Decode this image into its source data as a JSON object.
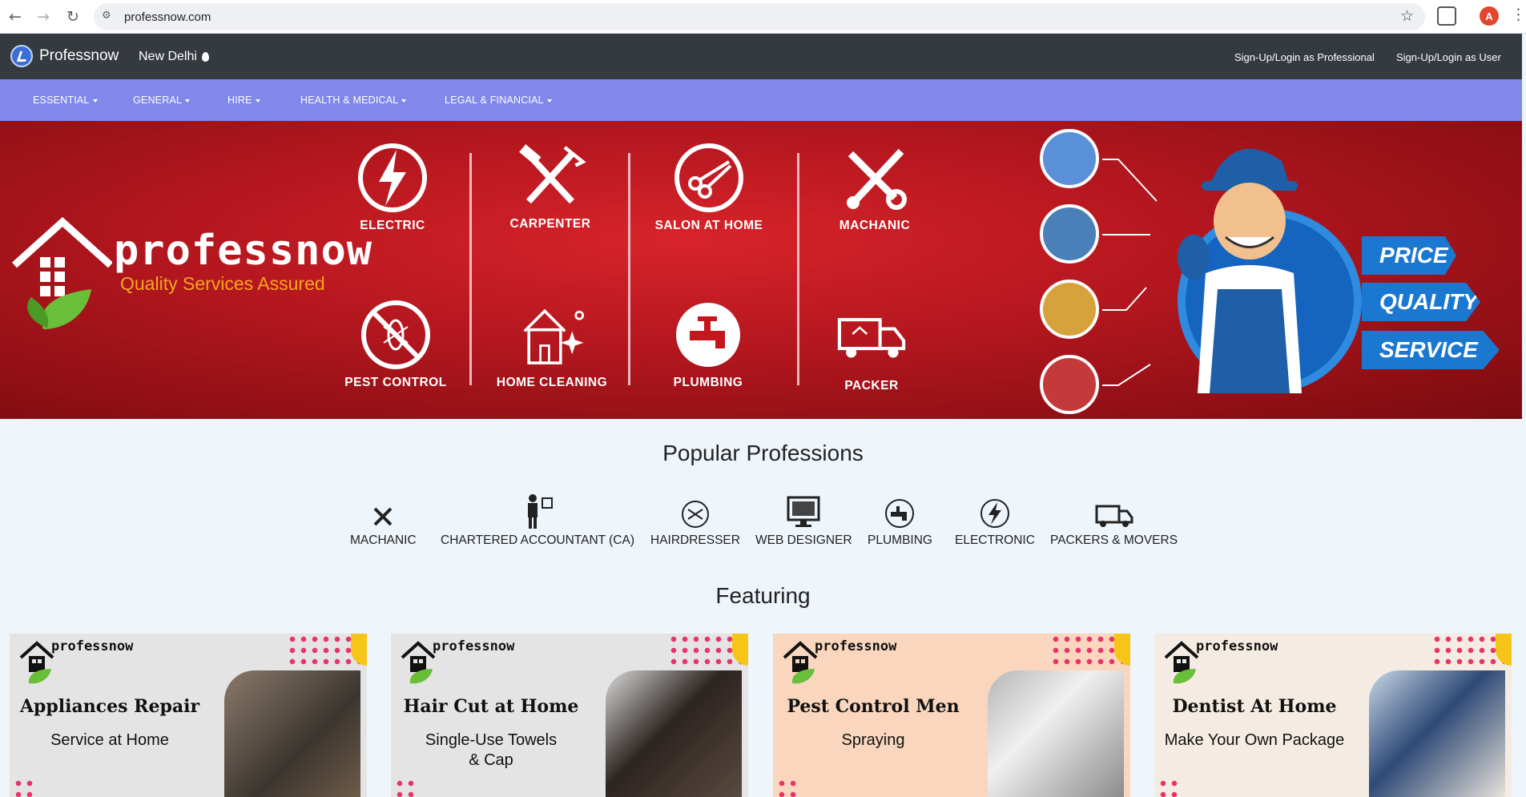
{
  "browser": {
    "url": "professnow.com",
    "profile_initial": "A"
  },
  "header": {
    "brand": "Professnow",
    "city": "New Delhi",
    "login_professional": "Sign-Up/Login as Professional",
    "login_user": "Sign-Up/Login as User"
  },
  "categories": [
    {
      "label": "ESSENTIAL"
    },
    {
      "label": "GENERAL"
    },
    {
      "label": "HIRE"
    },
    {
      "label": "HEALTH & MEDICAL"
    },
    {
      "label": "LEGAL & FINANCIAL"
    }
  ],
  "hero": {
    "logo_text": "professnow",
    "tagline": "Quality Services Assured",
    "services": [
      {
        "label": "ELECTRIC",
        "icon": "lightning-icon"
      },
      {
        "label": "CARPENTER",
        "icon": "hammer-saw-icon"
      },
      {
        "label": "SALON AT HOME",
        "icon": "scissors-comb-icon"
      },
      {
        "label": "MACHANIC",
        "icon": "wrench-screwdriver-icon"
      },
      {
        "label": "PEST CONTROL",
        "icon": "mosquito-icon"
      },
      {
        "label": "HOME CLEANING",
        "icon": "sparkle-house-icon"
      },
      {
        "label": "PLUMBING",
        "icon": "tap-icon"
      },
      {
        "label": "PACKER",
        "icon": "truck-icon"
      }
    ],
    "badges": [
      "PRICE",
      "QUALITY",
      "SERVICE"
    ]
  },
  "popular": {
    "title": "Popular Professions",
    "items": [
      {
        "label": "MACHANIC",
        "icon": "tools-icon"
      },
      {
        "label": "CHARTERED ACCOUNTANT (CA)",
        "icon": "accountant-icon"
      },
      {
        "label": "HAIRDRESSER",
        "icon": "scissors-icon"
      },
      {
        "label": "WEB DESIGNER",
        "icon": "monitor-icon"
      },
      {
        "label": "PLUMBING",
        "icon": "tap-icon"
      },
      {
        "label": "ELECTRONIC",
        "icon": "lightning-icon"
      },
      {
        "label": "PACKERS & MOVERS",
        "icon": "truck-icon"
      }
    ]
  },
  "featuring": {
    "title": "Featuring",
    "cards": [
      {
        "brand": "professnow",
        "title": "Appliances Repair",
        "subtitle": "Service at Home",
        "bg": "#e4e4e4"
      },
      {
        "brand": "professnow",
        "title": "Hair Cut at Home",
        "subtitle": "Single-Use Towels & Cap",
        "bg": "#e4e4e4"
      },
      {
        "brand": "professnow",
        "title": "Pest Control Men",
        "subtitle": "Spraying",
        "bg": "#f9d6bd"
      },
      {
        "brand": "professnow",
        "title": "Dentist At Home",
        "subtitle": "Make Your Own Package",
        "bg": "#f4ece2"
      }
    ]
  }
}
